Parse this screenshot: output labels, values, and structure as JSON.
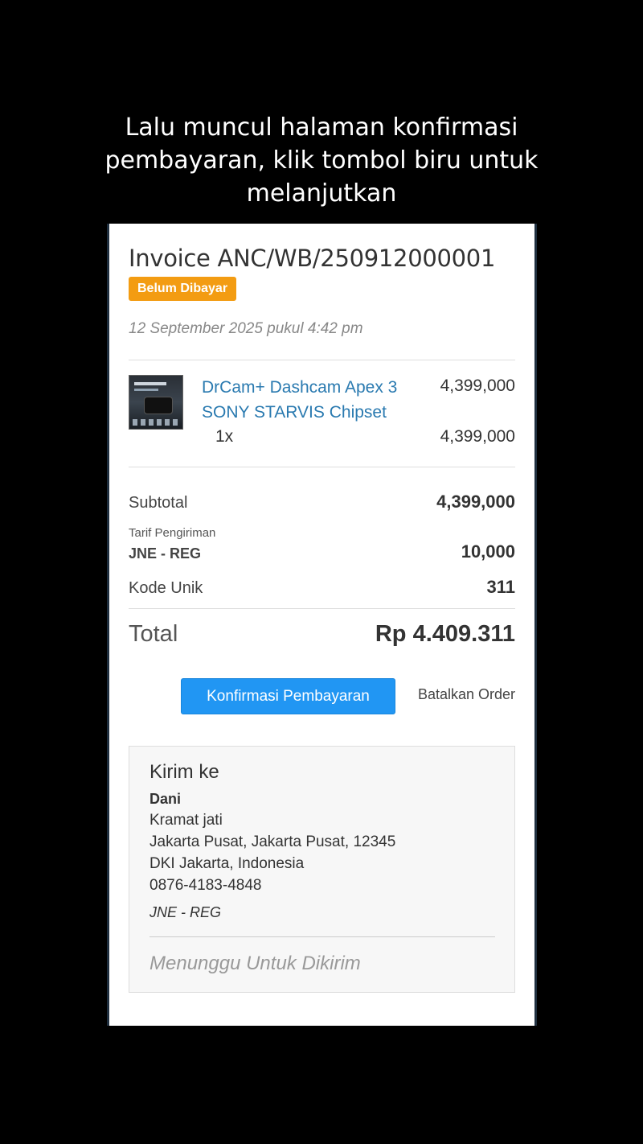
{
  "caption": "Lalu muncul halaman konfirmasi pembayaran, klik tombol biru untuk melanjutkan",
  "invoice": {
    "title": "Invoice ANC/WB/250912000001",
    "status_badge": "Belum Dibayar",
    "date": "12 September 2025 pukul 4:42 pm"
  },
  "item": {
    "name": "DrCam+ Dashcam Apex 3 SONY STARVIS Chipset",
    "price": "4,399,000",
    "qty": "1x",
    "line_total": "4,399,000"
  },
  "summary": {
    "subtotal_label": "Subtotal",
    "subtotal_value": "4,399,000",
    "shipping_label": "Tarif Pengiriman",
    "shipping_courier": "JNE - REG",
    "shipping_value": "10,000",
    "unique_code_label": "Kode Unik",
    "unique_code_value": "311",
    "total_label": "Total",
    "total_value": "Rp 4.409.311"
  },
  "actions": {
    "confirm_label": "Konfirmasi Pembayaran",
    "cancel_label": "Batalkan Order"
  },
  "shipping": {
    "title": "Kirim ke",
    "name": "Dani",
    "address_line1": "Kramat jati",
    "address_line2": "Jakarta Pusat, Jakarta Pusat, 12345",
    "address_line3": "DKI Jakarta, Indonesia",
    "phone": "0876-4183-4848",
    "courier": "JNE - REG",
    "status": "Menunggu Untuk Dikirim"
  },
  "colors": {
    "badge": "#f39c12",
    "primary_button": "#2196f3",
    "product_link": "#2a7ab0"
  }
}
